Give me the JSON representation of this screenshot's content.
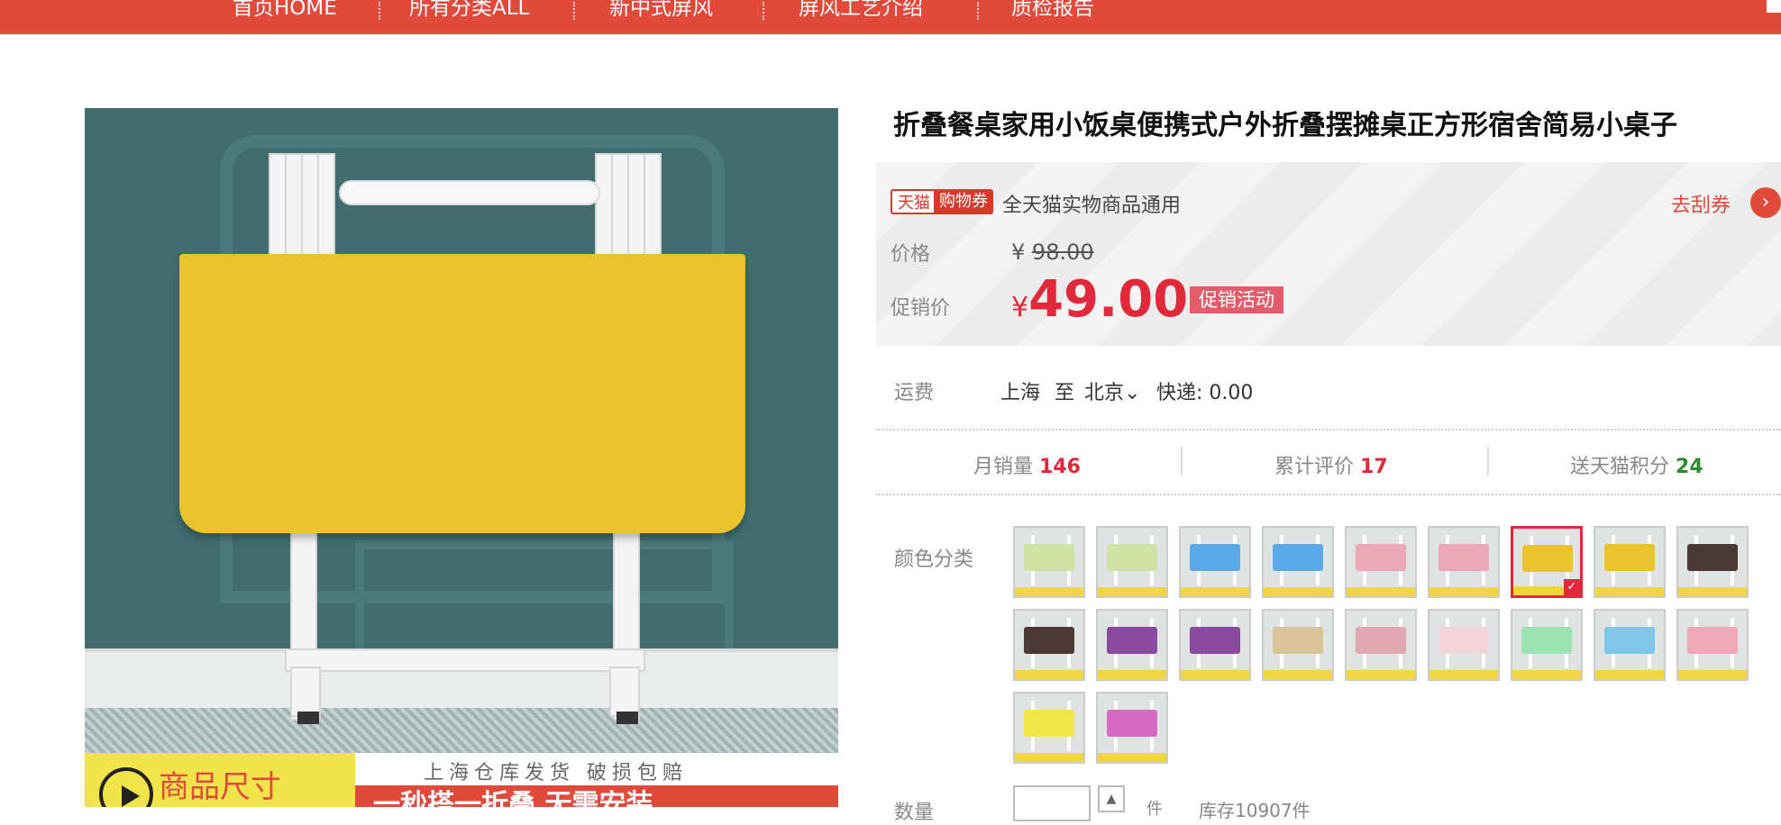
{
  "nav": {
    "items": [
      "首页HOME",
      "所有分类ALL",
      "新中式屏风",
      "屏风工艺介绍",
      "质检报告"
    ]
  },
  "product": {
    "title": "折叠餐桌家用小饭桌便携式户外折叠摆摊桌正方形宿舍简易小桌子",
    "image_banner": {
      "left_text": "商品尺寸",
      "right_subtext": "上海仓库发货  破损包赔",
      "right_red_text": "一秒搭一折叠  无需安装"
    }
  },
  "coupon": {
    "badge_tmall": "天猫",
    "badge_coupon": "购物券",
    "description": "全天猫实物商品通用",
    "link": "去刮券",
    "arrow": "›"
  },
  "price": {
    "label": "价格",
    "currency": "¥",
    "original": "98.00",
    "promo_label": "促销价",
    "promo_value": "49.00",
    "promo_tag": "促销活动"
  },
  "shipping": {
    "label": "运费",
    "from": "上海",
    "to_word": "至",
    "to": "北京",
    "method": "快递: 0.00"
  },
  "stats": {
    "monthly_sales_label": "月销量",
    "monthly_sales": "146",
    "reviews_label": "累计评价",
    "reviews": "17",
    "points_label": "送天猫积分",
    "points": "24"
  },
  "variants": {
    "label": "颜色分类",
    "selected_index": 6,
    "swatches": [
      {
        "icon": "table-thumb",
        "color": "#cfe2a6"
      },
      {
        "icon": "table-thumb",
        "color": "#cfe2a6"
      },
      {
        "icon": "table-thumb",
        "color": "#5aa8e6"
      },
      {
        "icon": "table-thumb",
        "color": "#5aa8e6"
      },
      {
        "icon": "table-thumb",
        "color": "#eaa8b6"
      },
      {
        "icon": "table-thumb",
        "color": "#eaa8b6"
      },
      {
        "icon": "table-thumb",
        "color": "#e8c32e"
      },
      {
        "icon": "table-thumb",
        "color": "#e8c32e"
      },
      {
        "icon": "table-thumb",
        "color": "#4a3a32"
      },
      {
        "icon": "table-thumb",
        "color": "#4a3a32"
      },
      {
        "icon": "table-thumb",
        "color": "#8a4aa0"
      },
      {
        "icon": "table-thumb",
        "color": "#8a4aa0"
      },
      {
        "icon": "table-thumb",
        "color": "#d9c49a"
      },
      {
        "icon": "table-thumb",
        "color": "#e0a8b0"
      },
      {
        "icon": "table-thumb",
        "color": "#f3d4d8"
      },
      {
        "icon": "table-thumb",
        "color": "#9be3b2"
      },
      {
        "icon": "table-thumb",
        "color": "#7ec7e6"
      },
      {
        "icon": "table-thumb",
        "color": "#f0a8b8"
      },
      {
        "icon": "table-thumb",
        "color": "#f2e54a"
      },
      {
        "icon": "table-thumb",
        "color": "#d66ac2"
      }
    ]
  },
  "quantity": {
    "label": "数量",
    "unit": "件",
    "stock": "库存10907件"
  },
  "colors": {
    "accent": "#e1493b",
    "price_red": "#e1293b",
    "points_green": "#2e8b2e"
  }
}
